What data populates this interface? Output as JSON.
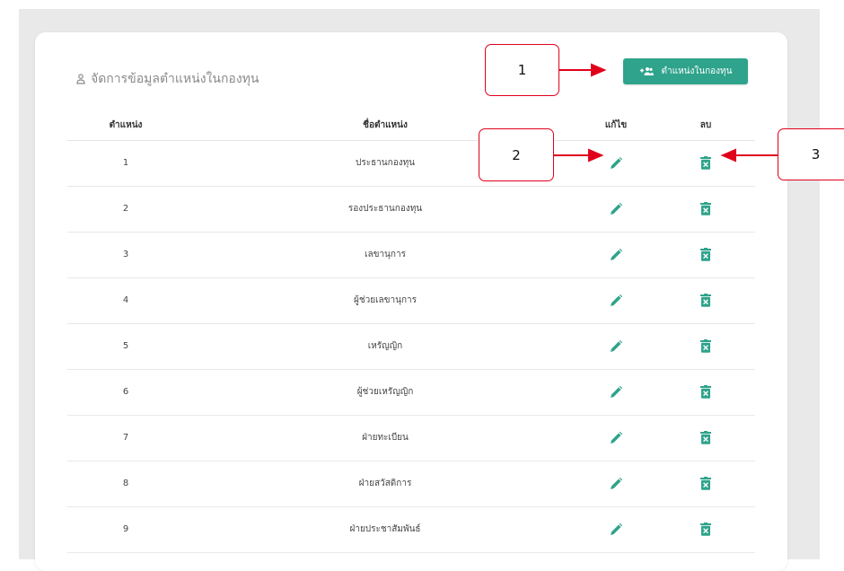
{
  "page": {
    "title": "จัดการข้อมูลตำแหน่งในกองทุน",
    "add_button_label": "ตำแหน่งในกองทุน"
  },
  "table": {
    "headers": {
      "order": "ตำแหน่ง",
      "name": "ชื่อตำแหน่ง",
      "edit": "แก้ไข",
      "delete": "ลบ"
    },
    "rows": [
      {
        "order": "1",
        "name": "ประธานกองทุน"
      },
      {
        "order": "2",
        "name": "รองประธานกองทุน"
      },
      {
        "order": "3",
        "name": "เลขานุการ"
      },
      {
        "order": "4",
        "name": "ผู้ช่วยเลขานุการ"
      },
      {
        "order": "5",
        "name": "เหรัญญิก"
      },
      {
        "order": "6",
        "name": "ผู้ช่วยเหรัญญิก"
      },
      {
        "order": "7",
        "name": "ฝ่ายทะเบียน"
      },
      {
        "order": "8",
        "name": "ฝ่ายสวัสดิการ"
      },
      {
        "order": "9",
        "name": "ฝ่ายประชาสัมพันธ์"
      }
    ]
  },
  "annotations": {
    "callout_1": "1",
    "callout_2": "2",
    "callout_3": "3"
  },
  "icons": {
    "title": "user-icon",
    "add_button": "add-group-icon",
    "edit": "pencil-icon",
    "delete": "trash-icon"
  },
  "colors": {
    "accent": "#2fa38c",
    "callout_border": "#e0001b",
    "arrow": "#e0001b"
  }
}
